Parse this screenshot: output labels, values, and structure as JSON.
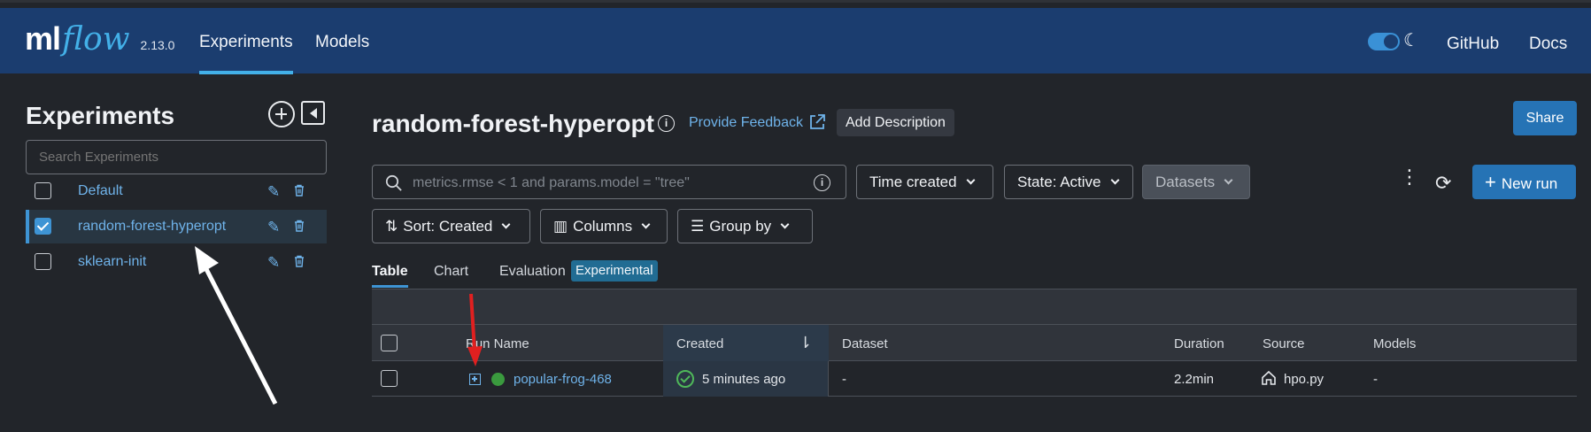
{
  "app": {
    "logo_ml": "ml",
    "logo_flow": "flow",
    "version": "2.13.0",
    "nav": [
      {
        "label": "Experiments",
        "active": true
      },
      {
        "label": "Models",
        "active": false
      }
    ],
    "github_label": "GitHub",
    "docs_label": "Docs",
    "dark_mode": true
  },
  "sidebar": {
    "title": "Experiments",
    "search_placeholder": "Search Experiments",
    "experiments": [
      {
        "name": "Default",
        "checked": false
      },
      {
        "name": "random-forest-hyperopt",
        "checked": true
      },
      {
        "name": "sklearn-init",
        "checked": false
      }
    ]
  },
  "main": {
    "title": "random-forest-hyperopt",
    "feedback_label": "Provide Feedback",
    "add_description_label": "Add Description",
    "share_label": "Share",
    "search_placeholder": "metrics.rmse < 1 and params.model = \"tree\"",
    "time_filter": "Time created",
    "state_filter": "State: Active",
    "datasets_filter": "Datasets",
    "sort_label": "Sort: Created",
    "columns_label": "Columns",
    "group_by_label": "Group by",
    "new_run_label": "New run",
    "tabs": [
      {
        "label": "Table",
        "active": true
      },
      {
        "label": "Chart",
        "active": false
      },
      {
        "label": "Evaluation",
        "active": false
      }
    ],
    "experimental_badge": "Experimental"
  },
  "table": {
    "columns": [
      "Run Name",
      "Created",
      "Dataset",
      "Duration",
      "Source",
      "Models"
    ],
    "rows": [
      {
        "run_name": "popular-frog-468",
        "status": "running",
        "created": "5 minutes ago",
        "dataset": "-",
        "duration": "2.2min",
        "source": "hpo.py",
        "models": "-"
      }
    ]
  },
  "colors": {
    "header_bg": "#1b3d6f",
    "page_bg": "#22252a",
    "accent": "#43b0e8",
    "link": "#6fb3ea",
    "primary_button": "#2673b5",
    "status_running": "#3a9a3e",
    "annotation_red": "#e02020"
  }
}
